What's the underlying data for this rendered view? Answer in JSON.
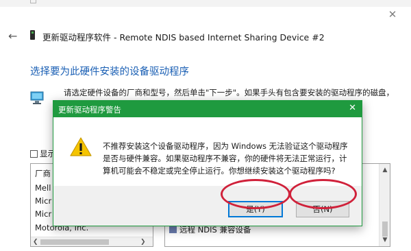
{
  "wizard": {
    "title": "更新驱动程序软件 - Remote NDIS based Internet Sharing Device #2",
    "heading": "选择要为此硬件安装的设备驱动程序",
    "instructions": "请选定硬件设备的厂商和型号，然后单击\"下一步\"。如果手头有包含要安装的驱动程序的磁盘，",
    "compatible_checkbox_label": "显示",
    "manufacturer_header": "厂商",
    "manufacturers": [
      "Mell",
      "Micr",
      "Micr",
      "Motorola, Inc."
    ],
    "model_item": "远程 NDIS 兼容设备"
  },
  "dialog": {
    "title": "更新驱动程序警告",
    "message_line1": "不推荐安装这个设备驱动程序，因为 Windows 无法验证这个驱动程序",
    "message_line2": "是否与硬件兼容。如果驱动程序不兼容，你的硬件将无法正常运行，计",
    "message_line3": "算机可能会不稳定或完全停止运行。你想继续安装这个驱动程序吗?",
    "yes_label": "是(Y)",
    "no_label": "否(N)"
  },
  "colors": {
    "dialog_titlebar": "#1f9a3f",
    "heading": "#1a5fb4",
    "highlight_ring": "#d0213a",
    "warning_icon": "#f5c400"
  },
  "icons": {
    "close": "close-icon",
    "back": "back-arrow-icon",
    "warning": "warning-icon",
    "device": "device-icon",
    "monitor": "monitor-icon"
  }
}
